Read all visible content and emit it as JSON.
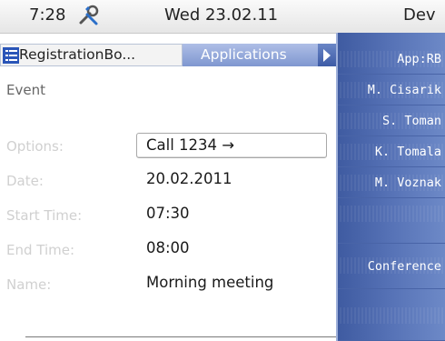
{
  "status_bar": {
    "time": "7:28",
    "tool_icon": "wrench-screwdriver-icon",
    "date": "Wed 23.02.11",
    "device": "Dev"
  },
  "tabs": {
    "active_label": "RegistrationBo...",
    "active_icon": "list-icon",
    "inactive_label": "Applications",
    "scroll_icon": "arrow-right-icon"
  },
  "event": {
    "heading": "Event",
    "fields": [
      {
        "label": "Options:",
        "value": "Call 1234 →"
      },
      {
        "label": "Date:",
        "value": "20.02.2011"
      },
      {
        "label": "Start Time:",
        "value": "07:30"
      },
      {
        "label": "End Time:",
        "value": "08:00"
      },
      {
        "label": "Name:",
        "value": "Morning meeting"
      }
    ]
  },
  "side_keys": [
    "App:RB",
    "M. Cisarik",
    "S. Toman",
    "K. Tomala",
    "M. Voznak",
    "",
    "Conference",
    ""
  ],
  "colors": {
    "accent_blue": "#5672b6",
    "tab_inactive": "#8ea4da",
    "label_gray": "#d0d0d0"
  }
}
